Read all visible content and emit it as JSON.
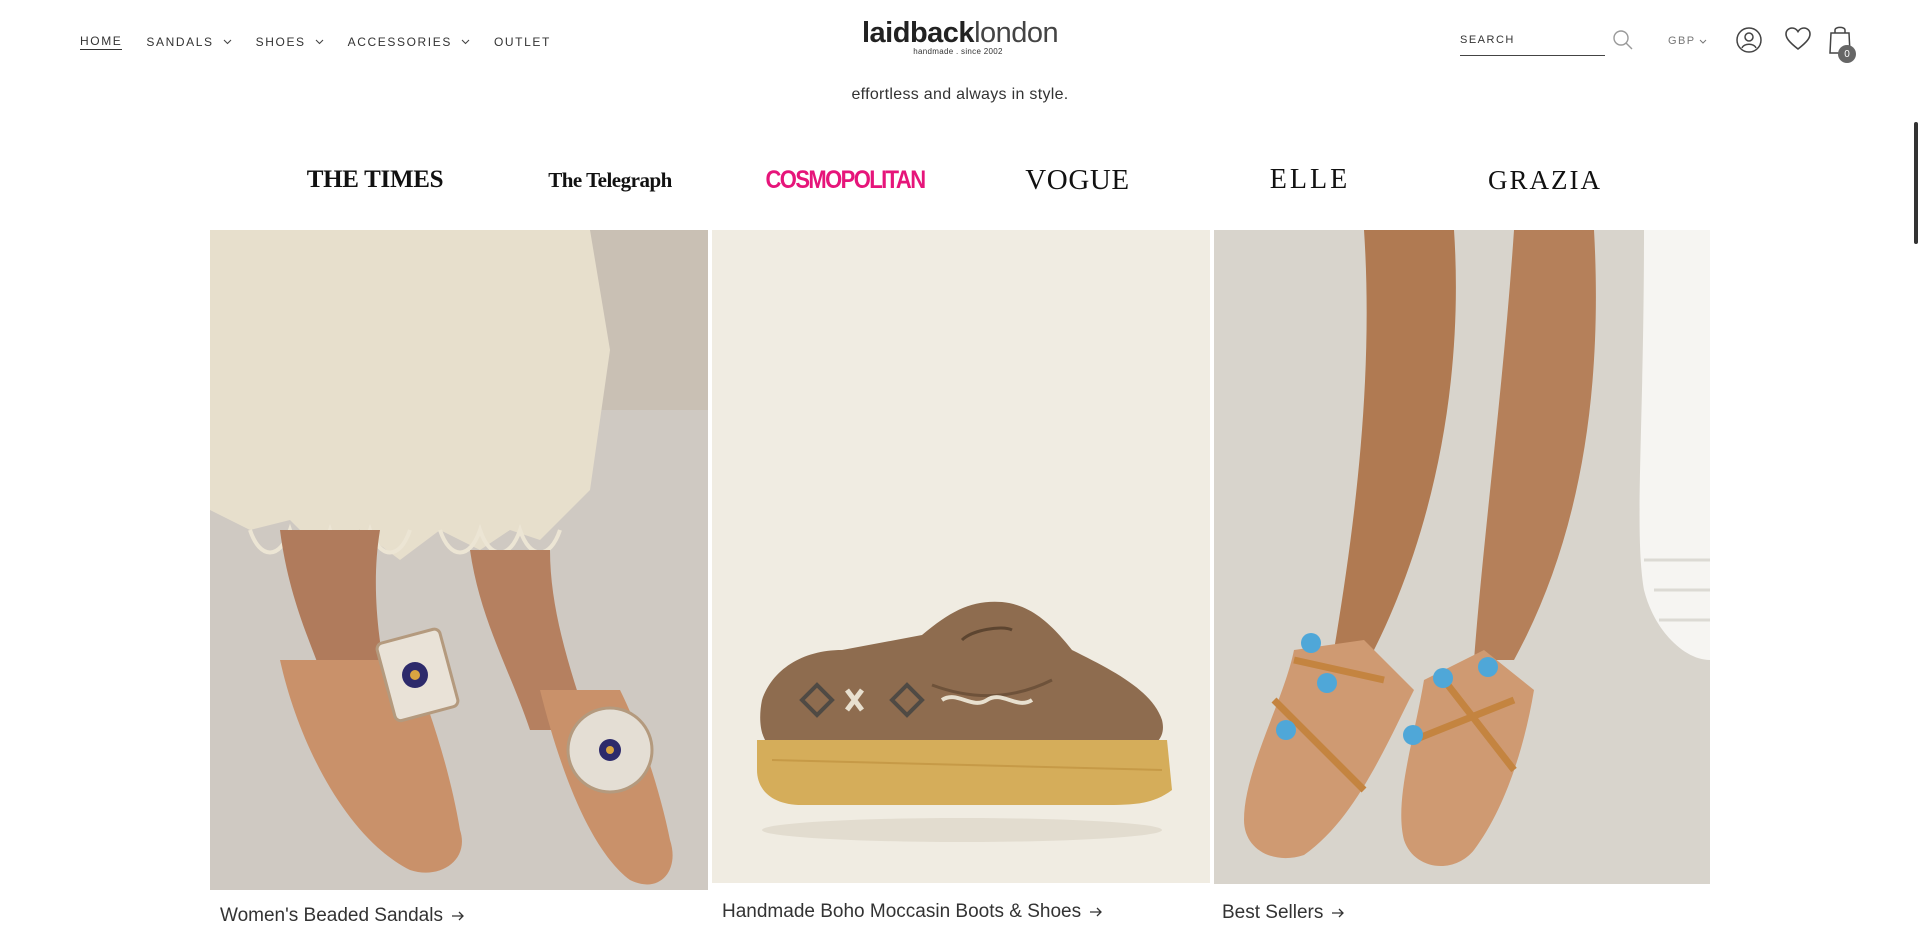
{
  "header": {
    "nav": [
      {
        "label": "HOME",
        "active": true,
        "dropdown": false
      },
      {
        "label": "SANDALS",
        "dropdown": true
      },
      {
        "label": "SHOES",
        "dropdown": true
      },
      {
        "label": "ACCESSORIES",
        "dropdown": true
      },
      {
        "label": "OUTLET",
        "dropdown": false
      }
    ],
    "logo": {
      "bold": "laidback",
      "light": "london",
      "sub": "handmade . since 2002"
    },
    "search": {
      "placeholder": "SEARCH",
      "icon": "search-icon"
    },
    "currency": "GBP",
    "cart_count": "0",
    "icons": [
      "account-icon",
      "wishlist-icon",
      "cart-icon"
    ]
  },
  "tagline": "effortless and always in style.",
  "press": [
    "THE TIMES",
    "The Telegraph",
    "COSMOPOLITAN",
    "VOGUE",
    "ELLE",
    "GRAZIA"
  ],
  "tiles": [
    {
      "caption": "Women's Beaded Sandals",
      "arrow": "→"
    },
    {
      "caption": "Handmade Boho Moccasin Boots & Shoes",
      "arrow": "→"
    },
    {
      "caption": "Best Sellers",
      "arrow": "→"
    }
  ],
  "colors": {
    "cosmopolitan": "#e6157a",
    "text": "#333333"
  }
}
